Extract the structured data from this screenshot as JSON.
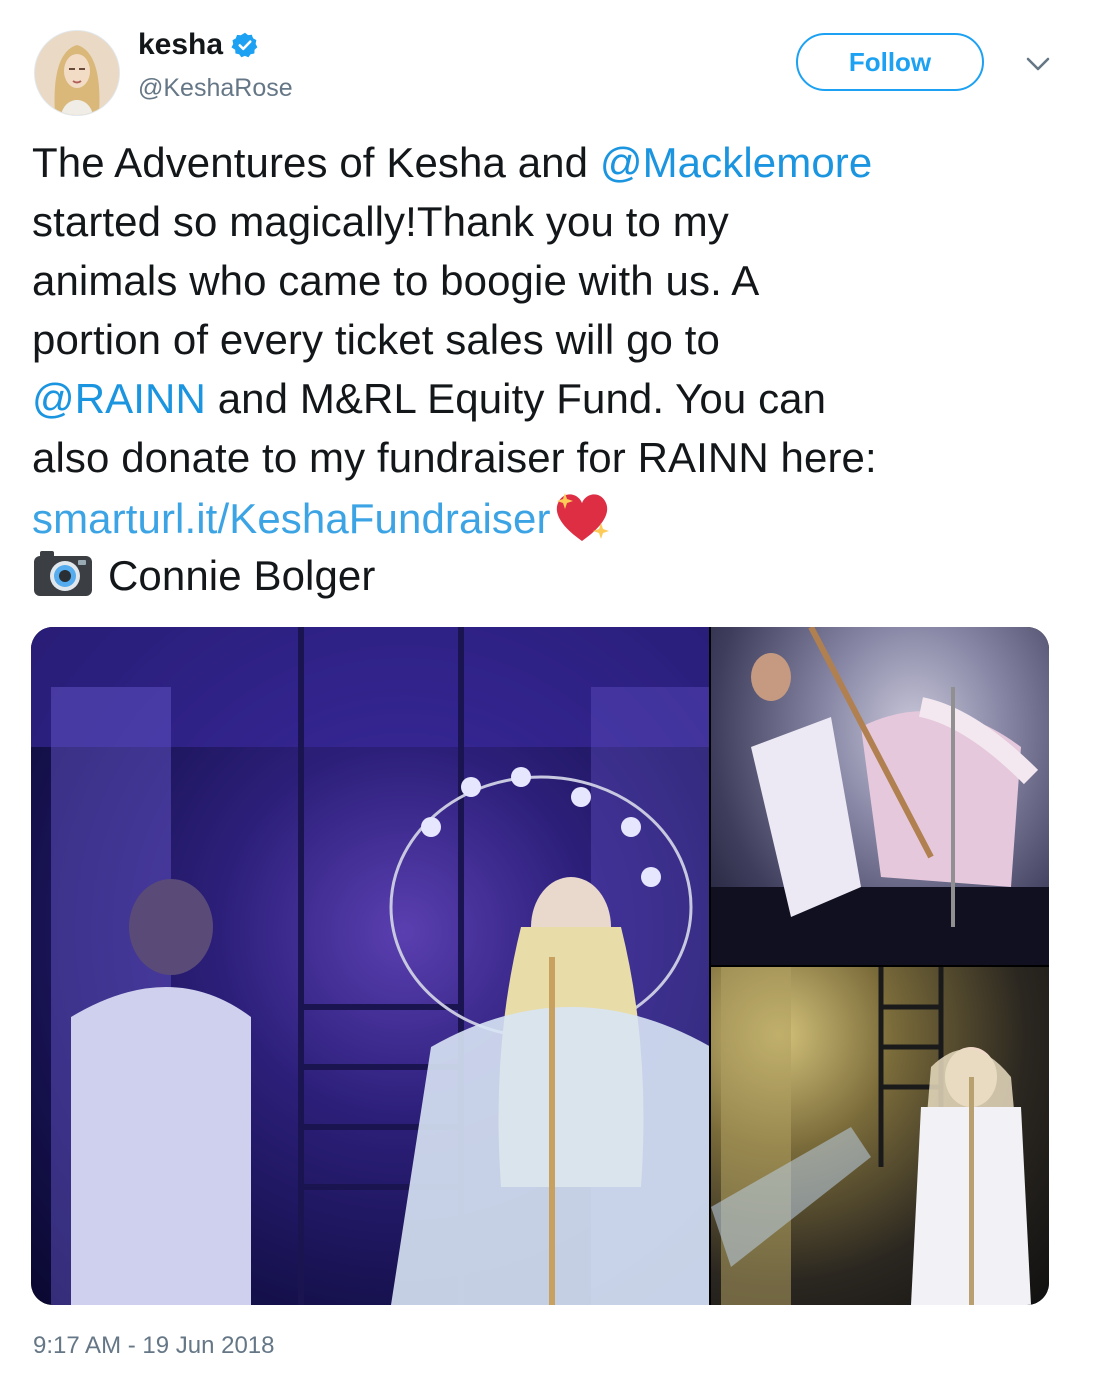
{
  "header": {
    "display_name": "kesha",
    "handle": "@KeshaRose",
    "follow_label": "Follow"
  },
  "tweet": {
    "lines": {
      "l1_text": "The Adventures of Kesha and ",
      "l1_mention": "@Macklemore",
      "l2": "started so magically!Thank you to my",
      "l3": "animals who came to boogie with us. A",
      "l4": "portion of every ticket sales will go to",
      "l5_mention": "@RAINN",
      "l5_text": " and M&RL Equity Fund. You can",
      "l6": "also donate to my fundraiser for RAINN here:",
      "l7_url": "smarturl.it/KeshaFundraiser",
      "l8_text": "Connie Bolger"
    }
  },
  "icons": {
    "verified": "verified-badge-icon",
    "caret": "chevron-down-icon",
    "heart": "sparkling-heart-emoji",
    "camera": "camera-emoji"
  },
  "colors": {
    "accent": "#1da1f2",
    "link": "#1b95e0",
    "muted": "#657786",
    "text": "#14171a"
  },
  "timestamp": "9:17 AM - 19 Jun 2018"
}
